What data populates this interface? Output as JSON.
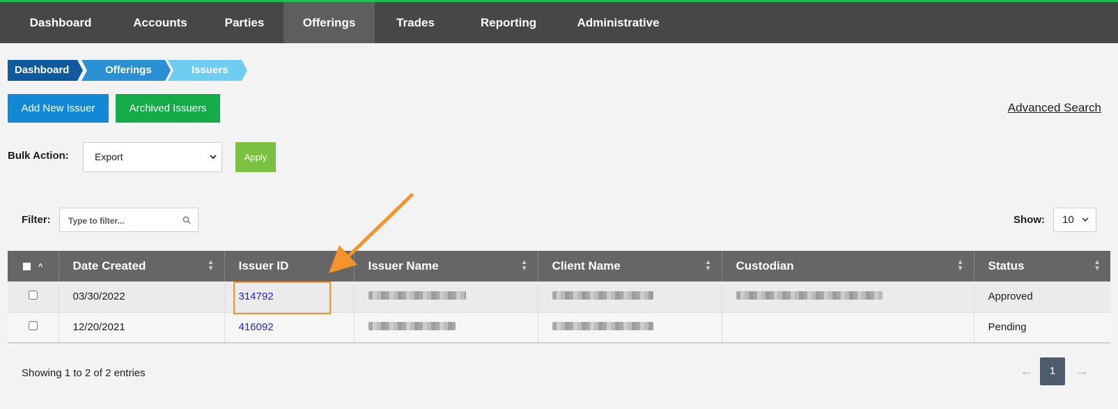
{
  "nav": {
    "items": [
      {
        "label": "Dashboard",
        "active": false
      },
      {
        "label": "Accounts",
        "active": false
      },
      {
        "label": "Parties",
        "active": false
      },
      {
        "label": "Offerings",
        "active": true
      },
      {
        "label": "Trades",
        "active": false
      },
      {
        "label": "Reporting",
        "active": false
      },
      {
        "label": "Administrative",
        "active": false
      }
    ]
  },
  "breadcrumb": [
    "Dashboard",
    "Offerings",
    "Issuers"
  ],
  "actions": {
    "add_label": "Add New Issuer",
    "archived_label": "Archived Issuers",
    "advanced_search": "Advanced Search"
  },
  "bulk": {
    "label": "Bulk Action:",
    "selected": "Export",
    "apply_label": "Apply"
  },
  "filter": {
    "label": "Filter:",
    "placeholder": "Type to filter..."
  },
  "show": {
    "label": "Show:",
    "value": "10"
  },
  "table": {
    "headers": [
      "Date Created",
      "Issuer ID",
      "Issuer Name",
      "Client Name",
      "Custodian",
      "Status"
    ],
    "rows": [
      {
        "date": "03/30/2022",
        "issuer_id": "314792",
        "status": "Approved"
      },
      {
        "date": "12/20/2021",
        "issuer_id": "416092",
        "status": "Pending"
      }
    ]
  },
  "footer": {
    "showing": "Showing 1 to 2 of 2 entries",
    "current_page": "1",
    "prev": "←",
    "next": "→"
  },
  "colors": {
    "nav_bg": "#474747",
    "accent_green": "#13ac49",
    "primary_blue": "#1389d6",
    "annotation_orange": "#f5922a"
  }
}
